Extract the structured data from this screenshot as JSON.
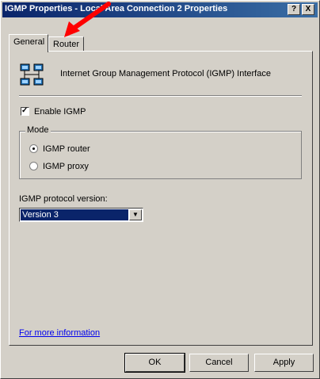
{
  "window": {
    "title": "IGMP Properties - Local Area Connection 2 Properties",
    "help_button": "?",
    "close_button": "X"
  },
  "tabs": [
    {
      "label": "General",
      "active": true
    },
    {
      "label": "Router",
      "active": false
    }
  ],
  "general": {
    "interface_label": "Internet Group Management Protocol (IGMP) Interface",
    "enable_igmp": {
      "label": "Enable IGMP",
      "checked": true
    },
    "mode": {
      "legend": "Mode",
      "options": [
        {
          "label": "IGMP router",
          "selected": true
        },
        {
          "label": "IGMP proxy",
          "selected": false
        }
      ]
    },
    "protocol_version": {
      "label": "IGMP protocol version:",
      "selected": "Version 3"
    },
    "more_info_link": "For more information"
  },
  "buttons": {
    "ok": "OK",
    "cancel": "Cancel",
    "apply": "Apply"
  },
  "colors": {
    "titlebar_start": "#0a246a",
    "titlebar_end": "#3a6ea5",
    "dialog_bg": "#d4d0c8",
    "annotation_arrow": "#ff0000"
  },
  "icons": [
    "network-interface-icon",
    "annotation-arrow"
  ]
}
